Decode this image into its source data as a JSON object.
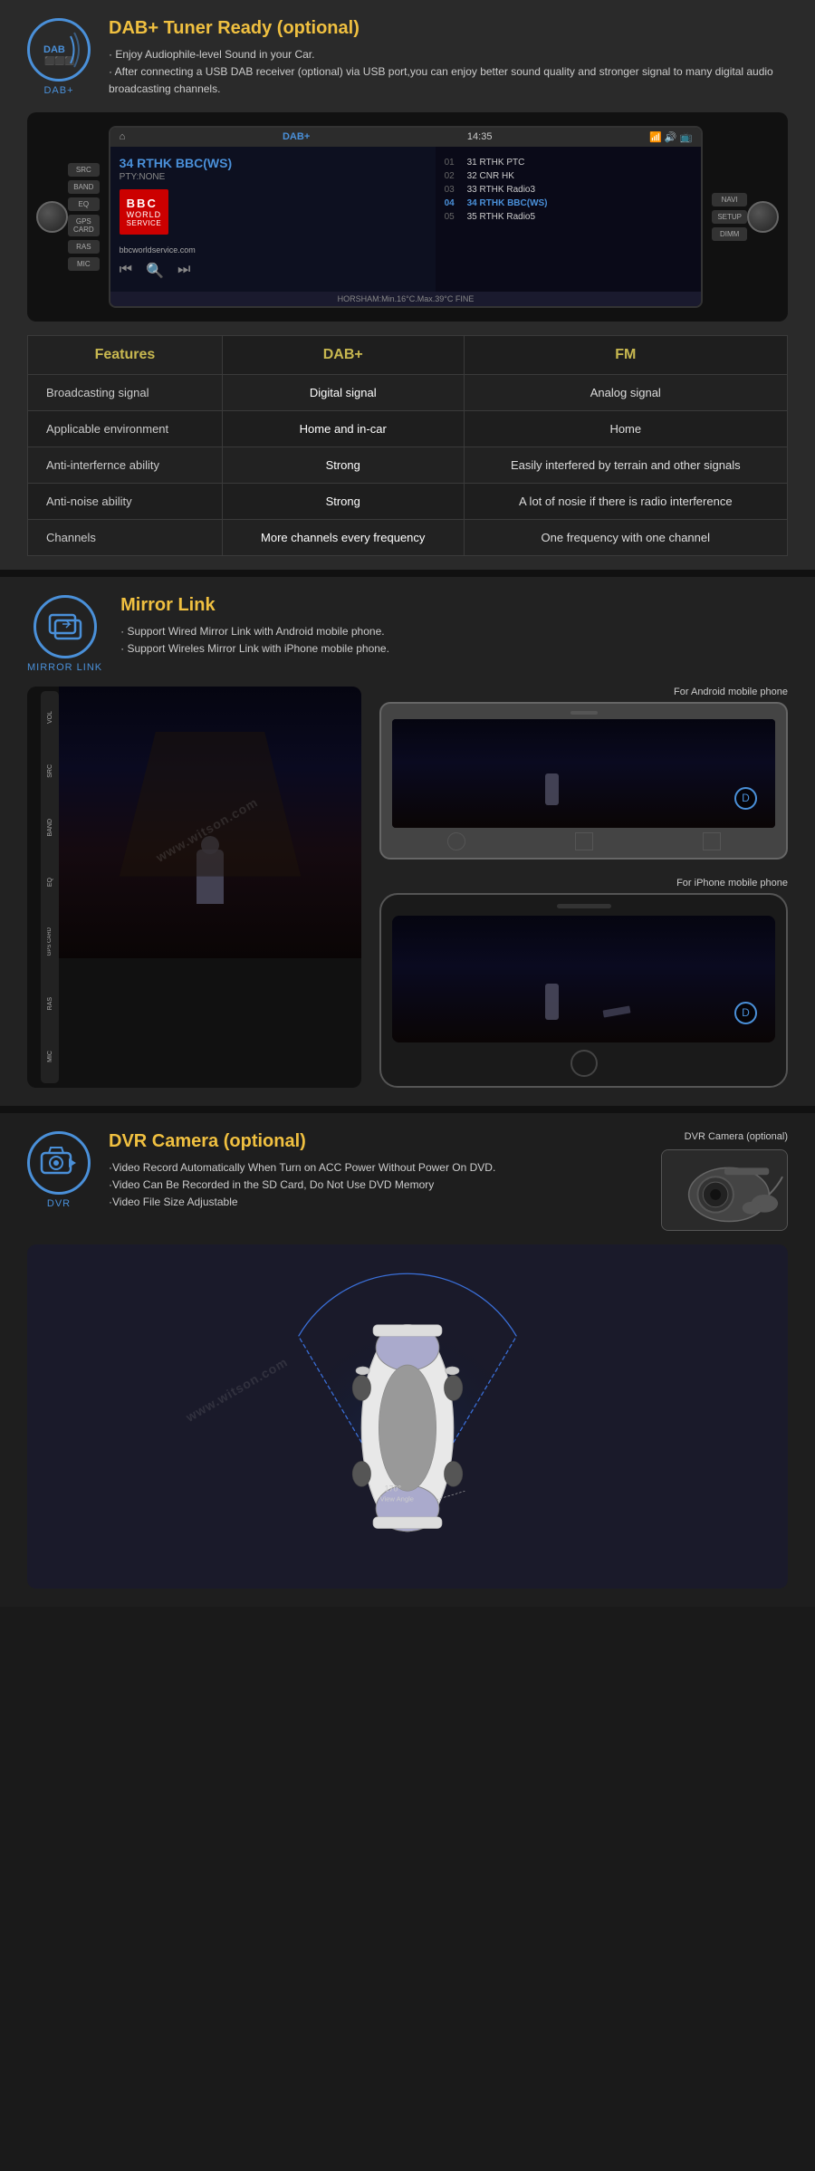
{
  "dab": {
    "icon_label": "DAB+",
    "title": "DAB+ Tuner Ready (optional)",
    "desc_line1": "· Enjoy Audiophile-level Sound in your Car.",
    "desc_line2": "· After connecting a USB DAB receiver (optional) via USB port,you can enjoy better sound quality and stronger signal to many digital audio broadcasting channels.",
    "screen": {
      "source": "DAB+",
      "time": "14:35",
      "station": "34 RTHK BBC(WS)",
      "pty": "PTY:NONE",
      "bbc_line1": "BBC",
      "bbc_line2": "WORLD",
      "bbc_line3": "SERVICE",
      "bbc_url": "bbcworldservice.com",
      "channels": [
        {
          "num": "01",
          "name": "31 RTHK PTC"
        },
        {
          "num": "02",
          "name": "32 CNR HK"
        },
        {
          "num": "03",
          "name": "33 RTHK Radio3"
        },
        {
          "num": "04",
          "name": "34 RTHK BBC(WS)",
          "active": true
        },
        {
          "num": "05",
          "name": "35 RTHK Radio5"
        }
      ],
      "status": "HORSHAM:Min.16°C.Max.39°C FINE"
    },
    "table": {
      "headers": [
        "Features",
        "DAB+",
        "FM"
      ],
      "rows": [
        {
          "feature": "Broadcasting signal",
          "dab": "Digital signal",
          "fm": "Analog signal"
        },
        {
          "feature": "Applicable environment",
          "dab": "Home and in-car",
          "fm": "Home"
        },
        {
          "feature": "Anti-interfernce ability",
          "dab": "Strong",
          "fm": "Easily interfered by terrain and other signals"
        },
        {
          "feature": "Anti-noise ability",
          "dab": "Strong",
          "fm": "A lot of nosie if there is radio interference"
        },
        {
          "feature": "Channels",
          "dab": "More channels every frequency",
          "fm": "One frequency with one channel"
        }
      ]
    }
  },
  "mirror": {
    "icon_label": "MIRROR LINK",
    "title": "Mirror Link",
    "desc_line1": "· Support Wired Mirror Link with Android mobile phone.",
    "desc_line2": "· Support Wireles Mirror Link with iPhone mobile phone.",
    "android_label": "For Android mobile phone",
    "iphone_label": "For iPhone mobile phone"
  },
  "dvr": {
    "icon_label": "DVR",
    "title": "DVR Camera (optional)",
    "desc_line1": "·Video Record Automatically When Turn on ACC Power Without Power On DVD.",
    "desc_line2": "·Video Can Be Recorded in the SD Card, Do Not Use DVD Memory",
    "desc_line3": "·Video File Size Adjustable",
    "camera_label": "DVR Camera (optional)",
    "view_angle": "170°",
    "view_text": "View Angle"
  },
  "watermark": "www.witson.com"
}
